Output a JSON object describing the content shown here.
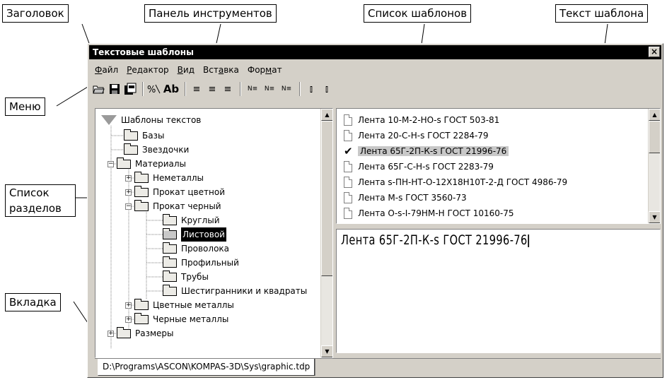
{
  "callouts": {
    "title": "Заголовок",
    "toolbar": "Панель инструментов",
    "template_list": "Список шаблонов",
    "template_text": "Текст шаблона",
    "menu": "Меню",
    "sections_line1": "Список",
    "sections_line2": "разделов",
    "tab": "Вкладка"
  },
  "window": {
    "title": "Текстовые шаблоны",
    "close": "×"
  },
  "menu": [
    {
      "accel": "Ф",
      "rest": "айл"
    },
    {
      "accel": "Р",
      "rest": "едактор"
    },
    {
      "accel": "В",
      "rest": "ид"
    },
    {
      "pre": "Вст",
      "accel": "а",
      "rest": "вка"
    },
    {
      "pre": "Фор",
      "accel": "м",
      "rest": "ат"
    }
  ],
  "toolbar": {
    "open_icon": "folder-open-icon",
    "save_icon": "save-icon",
    "copy_icon": "copy-icon",
    "replace_icon": "replace-icon",
    "font_label": "Ab",
    "align_left": "≡",
    "align_center": "≡",
    "align_right": "≡",
    "num1": "N≡",
    "num2": "N≡",
    "num3": "N≡",
    "insert1": "⫾",
    "insert2": "⫾"
  },
  "tree": {
    "root": "Шаблоны текстов",
    "items": [
      {
        "label": "Базы"
      },
      {
        "label": "Звездочки"
      },
      {
        "label": "Материалы"
      },
      {
        "label": "Неметаллы"
      },
      {
        "label": "Прокат цветной"
      },
      {
        "label": "Прокат черный"
      },
      {
        "label": "Круглый"
      },
      {
        "label": "Листовой"
      },
      {
        "label": "Проволока"
      },
      {
        "label": "Профильный"
      },
      {
        "label": "Трубы"
      },
      {
        "label": "Шестигранники и квадраты"
      },
      {
        "label": "Цветные металлы"
      },
      {
        "label": "Черные металлы"
      },
      {
        "label": "Размеры"
      }
    ]
  },
  "templates": [
    "Лента 10-М-2-НО-s ГОСТ 503-81",
    "Лента 20-С-Н-s ГОСТ 2284-79",
    "Лента 65Г-2П-К-s ГОСТ 21996-76",
    "Лента 65Г-С-Н-s ГОСТ 2283-79",
    "Лента s-ПН-НТ-О-12Х18Н10Т-2-Д ГОСТ 4986-79",
    "Лента М-s ГОСТ 3560-73",
    "Лента О-s-I-79НМ-Н ГОСТ 10160-75"
  ],
  "template_text": "Лента 65Г-2П-К-s ГОСТ 21996-76",
  "tab_label": "D:\\Programs\\ASCON\\KOMPAS-3D\\Sys\\graphic.tdp"
}
